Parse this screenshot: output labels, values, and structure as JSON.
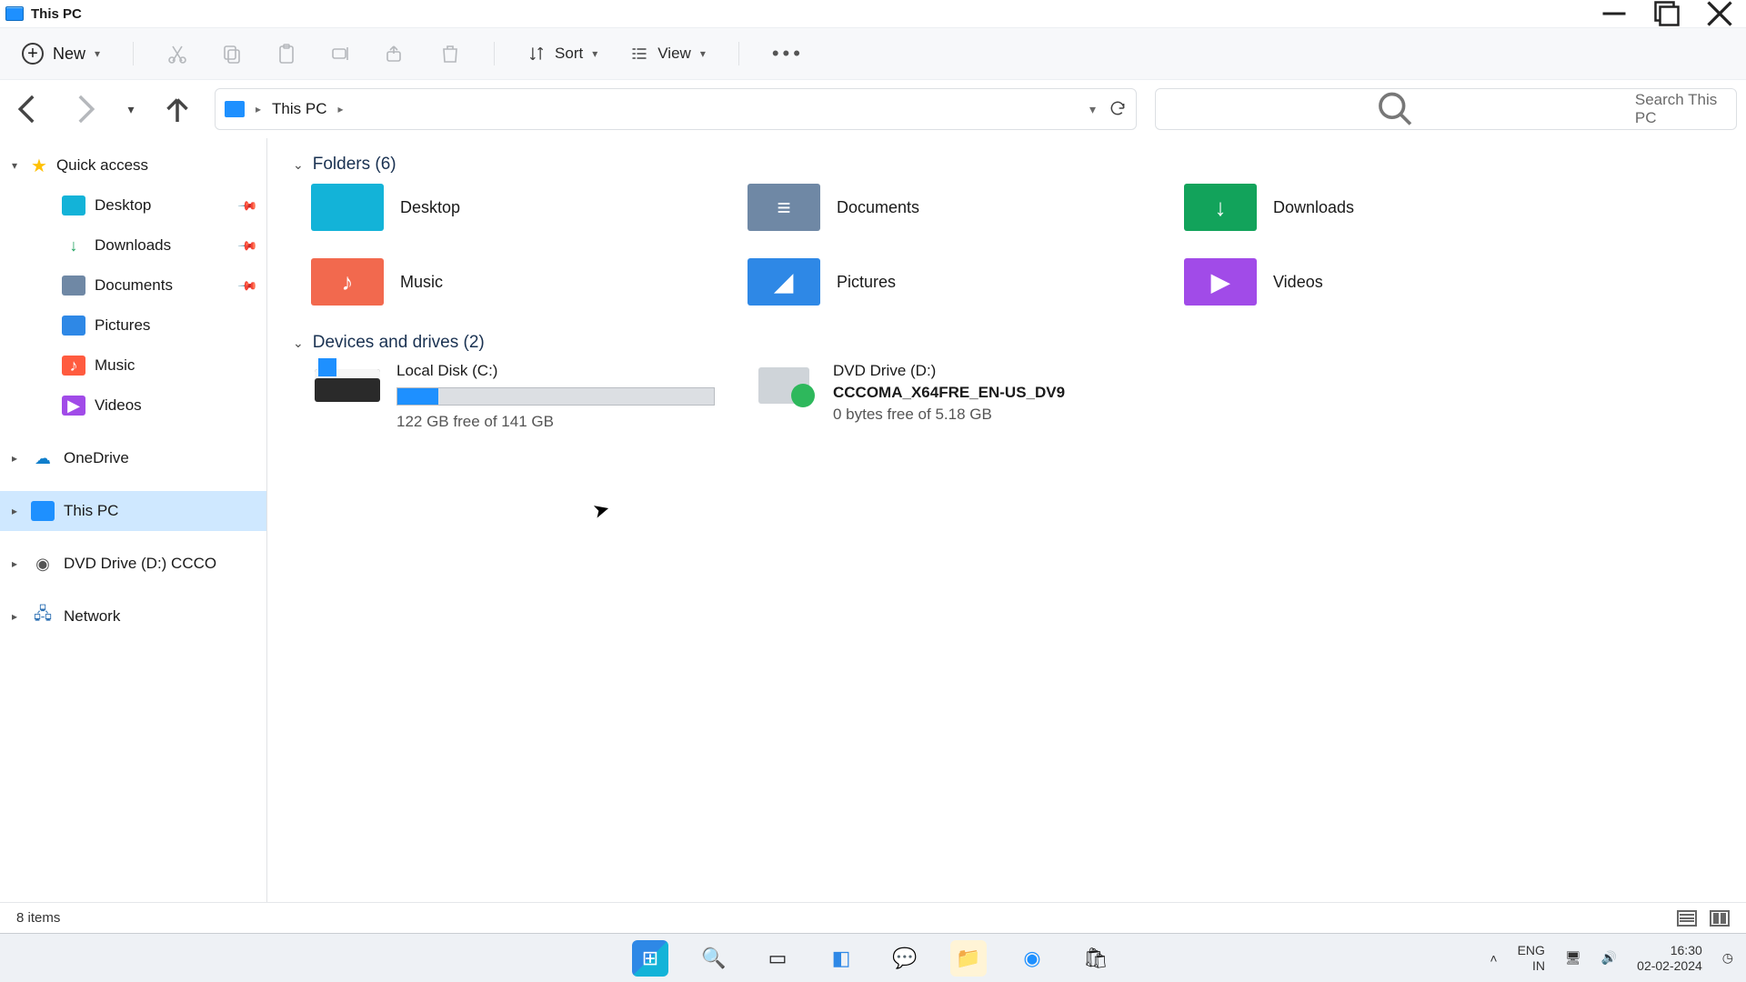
{
  "window": {
    "title": "This PC"
  },
  "toolbar": {
    "new": "New",
    "sort": "Sort",
    "view": "View"
  },
  "breadcrumb": {
    "root": "This PC"
  },
  "search": {
    "placeholder": "Search This PC"
  },
  "sidebar": {
    "quick_access": "Quick access",
    "desktop": "Desktop",
    "downloads": "Downloads",
    "documents": "Documents",
    "pictures": "Pictures",
    "music": "Music",
    "videos": "Videos",
    "onedrive": "OneDrive",
    "this_pc": "This PC",
    "dvd": "DVD Drive (D:) CCCO",
    "network": "Network"
  },
  "groups": {
    "folders_header": "Folders (6)",
    "drives_header": "Devices and drives (2)"
  },
  "folders": {
    "desktop": "Desktop",
    "documents": "Documents",
    "downloads": "Downloads",
    "music": "Music",
    "pictures": "Pictures",
    "videos": "Videos"
  },
  "drives": {
    "c_name": "Local Disk (C:)",
    "c_free": "122 GB free of 141 GB",
    "c_fill_pct": 13,
    "d_name": "DVD Drive (D:)",
    "d_label": "CCCOMA_X64FRE_EN-US_DV9",
    "d_free": "0 bytes free of 5.18 GB"
  },
  "status": {
    "items": "8 items"
  },
  "systray": {
    "lang1": "ENG",
    "lang2": "IN",
    "time": "16:30",
    "date": "02-02-2024"
  }
}
